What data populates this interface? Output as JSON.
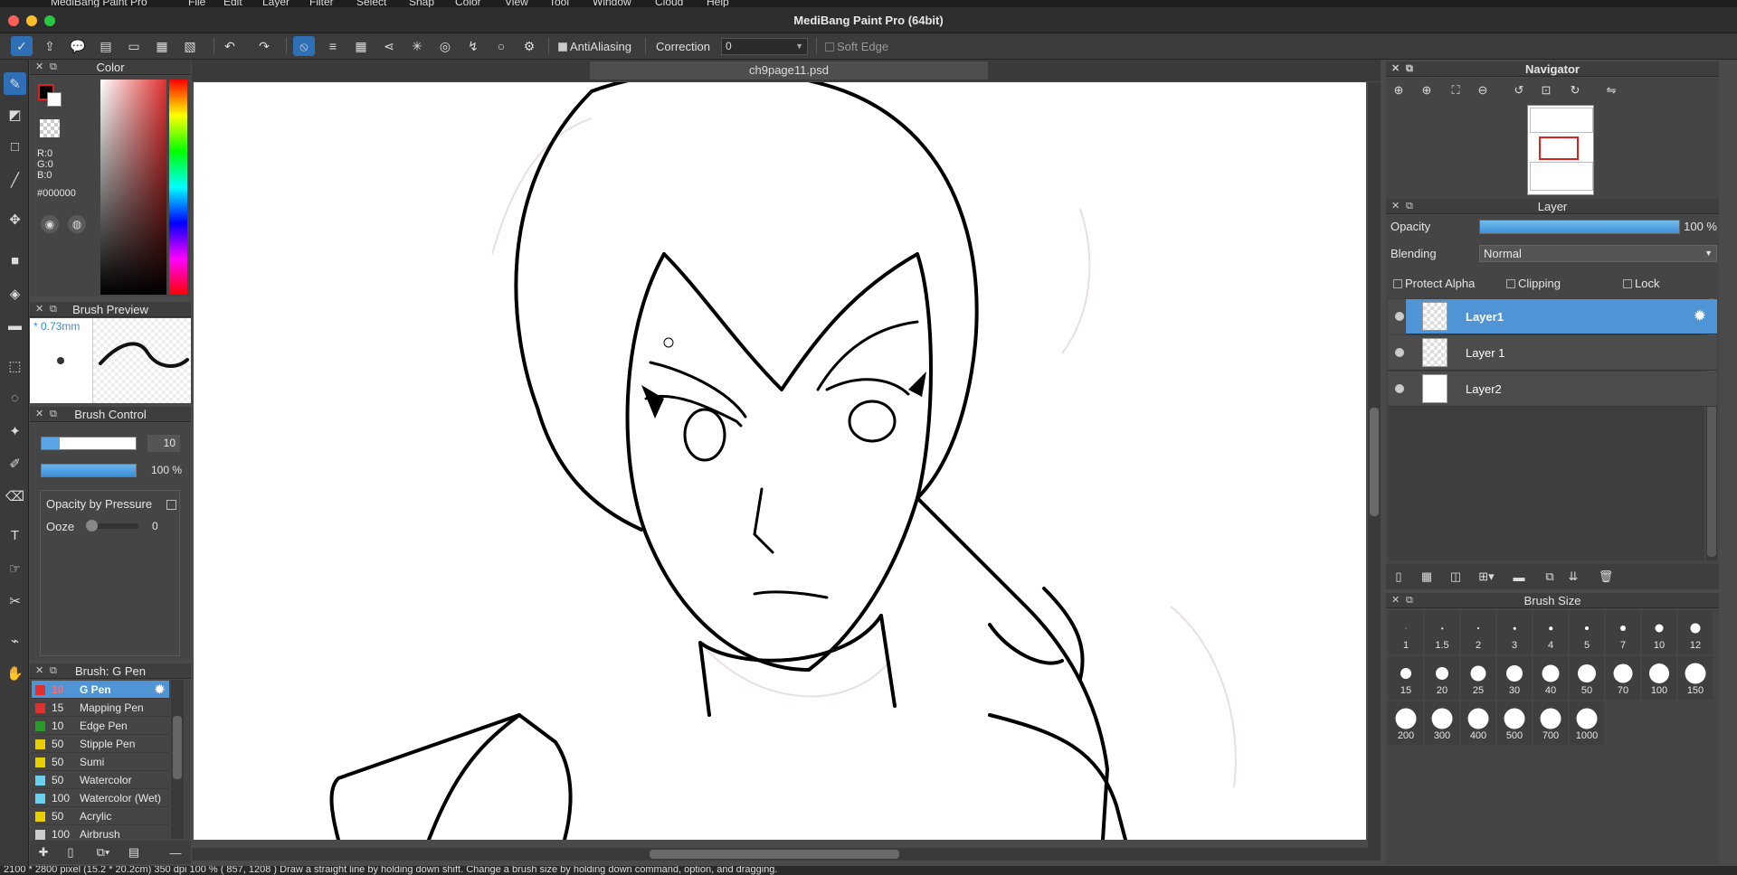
{
  "app": {
    "window_title": "MediBang Paint Pro (64bit)",
    "menu_items": [
      "MediBang Paint Pro",
      "File",
      "Edit",
      "Layer",
      "Filter",
      "Select",
      "Snap",
      "Color",
      "View",
      "Tool",
      "Window",
      "Cloud",
      "Help"
    ]
  },
  "toolbar": {
    "antialiasing_label": "AntiAliasing",
    "correction_label": "Correction",
    "correction_value": "0",
    "soft_edge_label": "Soft Edge"
  },
  "document": {
    "tab_title": "ch9page11.psd"
  },
  "color_panel": {
    "title": "Color",
    "r": "R:0",
    "g": "G:0",
    "b": "B:0",
    "hex": "#000000",
    "foreground": "#000000",
    "background": "#ffffff"
  },
  "brush_preview": {
    "title": "Brush Preview",
    "size_label": "* 0.73mm"
  },
  "brush_control": {
    "title": "Brush Control",
    "size_value": "10",
    "opacity_value": "100 %",
    "opacity_by_pressure_label": "Opacity by Pressure",
    "ooze_label": "Ooze",
    "ooze_value": "0"
  },
  "brush_list": {
    "title": "Brush: G Pen",
    "items": [
      {
        "size": "10",
        "name": "G Pen",
        "color": "#e03030"
      },
      {
        "size": "15",
        "name": "Mapping Pen",
        "color": "#e03030"
      },
      {
        "size": "10",
        "name": "Edge Pen",
        "color": "#2a9a2a"
      },
      {
        "size": "50",
        "name": "Stipple Pen",
        "color": "#e8d000"
      },
      {
        "size": "50",
        "name": "Sumi",
        "color": "#e8d000"
      },
      {
        "size": "50",
        "name": "Watercolor",
        "color": "#6ad0f0"
      },
      {
        "size": "100",
        "name": "Watercolor (Wet)",
        "color": "#6ad0f0"
      },
      {
        "size": "50",
        "name": "Acrylic",
        "color": "#e8d000"
      },
      {
        "size": "100",
        "name": "Airbrush",
        "color": "#cccccc"
      }
    ]
  },
  "navigator": {
    "title": "Navigator"
  },
  "layer_panel": {
    "title": "Layer",
    "opacity_label": "Opacity",
    "opacity_value": "100 %",
    "opacity_level": 1.0,
    "blending_label": "Blending",
    "blending_value": "Normal",
    "protect_alpha_label": "Protect Alpha",
    "clipping_label": "Clipping",
    "lock_label": "Lock",
    "layers": [
      {
        "name": "Layer1",
        "selected": true
      },
      {
        "name": "Layer 1",
        "selected": false
      },
      {
        "name": "Layer2",
        "selected": false
      }
    ]
  },
  "brush_size_panel": {
    "title": "Brush Size",
    "sizes": [
      "1",
      "1.5",
      "2",
      "3",
      "4",
      "5",
      "7",
      "10",
      "12",
      "15",
      "20",
      "25",
      "30",
      "40",
      "50",
      "70",
      "100",
      "150",
      "200",
      "300",
      "400",
      "500",
      "700",
      "1000"
    ]
  },
  "status": {
    "text": "2100 * 2800 pixel   (15.2 * 20.2cm)   350 dpi   100 %   ( 857, 1208 )   Draw a straight line by holding down shift. Change a brush size by holding down command, option, and dragging."
  }
}
